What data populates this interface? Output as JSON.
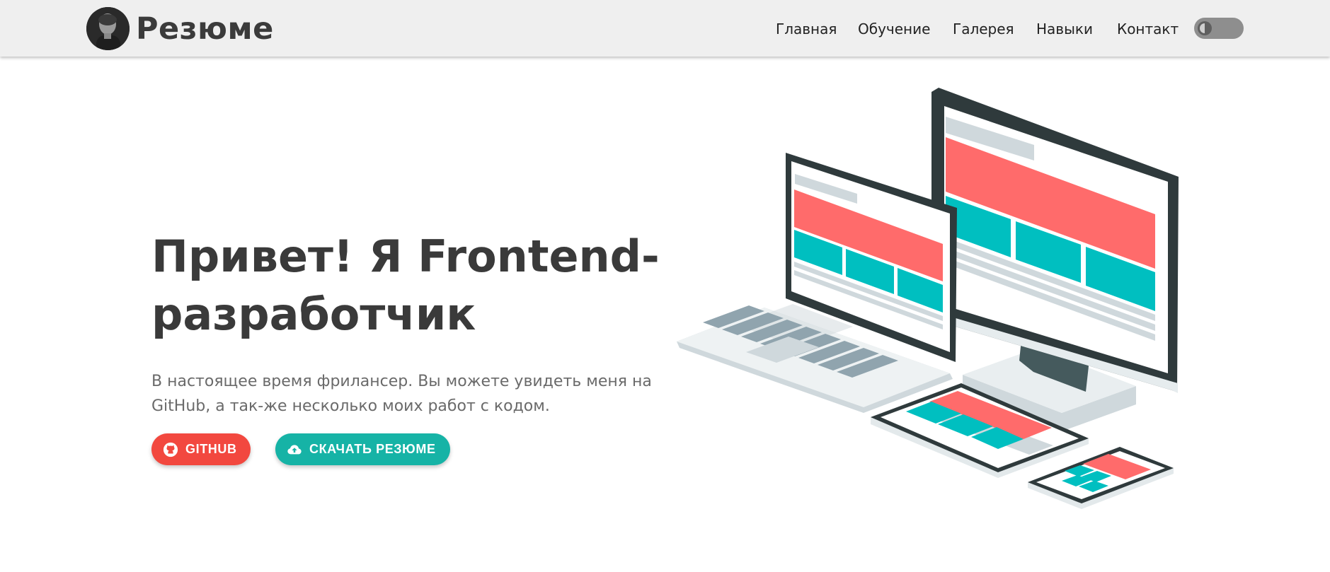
{
  "header": {
    "brand": "Резюме",
    "nav": [
      {
        "label": "Главная"
      },
      {
        "label": "Обучение"
      },
      {
        "label": "Галерея"
      },
      {
        "label": "Навыки"
      },
      {
        "label": "Контакт"
      }
    ]
  },
  "hero": {
    "title": "Привет! Я Frontend-разработчик",
    "text": "В настоящее время фрилансер. Вы можете увидеть меня на GitHub, а так-же несколько моих работ с кодом.",
    "buttons": {
      "github": "GITHUB",
      "resume": "СКАЧАТЬ РЕЗЮМЕ"
    }
  },
  "colors": {
    "accent_red": "#f2483f",
    "accent_teal": "#16b3a6",
    "illustration_red": "#ff6b6b",
    "illustration_teal": "#00bfc0",
    "header_bg": "#efefef"
  },
  "icons": {
    "github_button": "github-icon",
    "resume_button": "cloud-upload-icon",
    "theme_switch": "theme-toggle"
  }
}
